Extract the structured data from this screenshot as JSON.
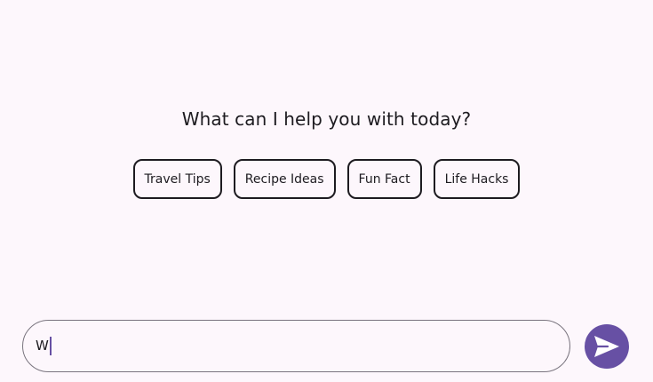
{
  "prompt": {
    "title": "What can I help you with today?"
  },
  "suggestions": [
    {
      "label": "Travel Tips"
    },
    {
      "label": "Recipe Ideas"
    },
    {
      "label": "Fun Fact"
    },
    {
      "label": "Life Hacks"
    }
  ],
  "composer": {
    "value": "W",
    "send_icon": "send-icon"
  },
  "colors": {
    "background": "#fdf7fc",
    "accent": "#6750a4",
    "outline": "#79747e",
    "text": "#1d1b20"
  }
}
